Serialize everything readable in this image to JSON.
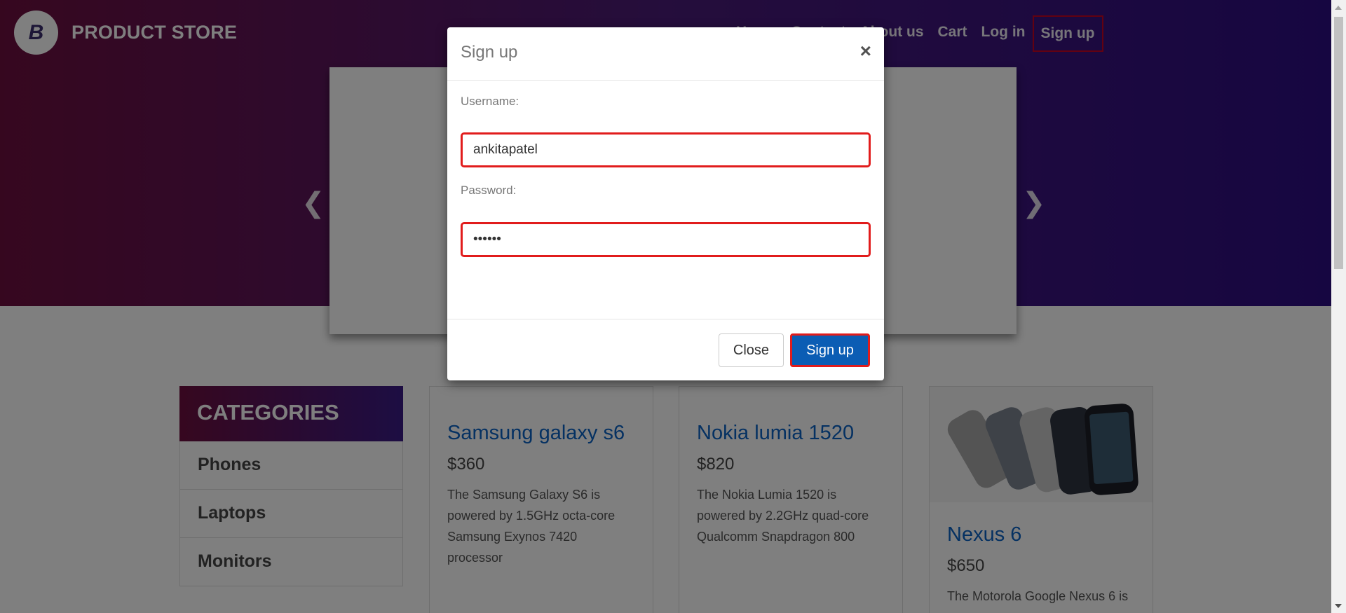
{
  "brand": {
    "name": "PRODUCT STORE",
    "logo_letter": "B"
  },
  "nav": {
    "items": [
      {
        "label": "Home"
      },
      {
        "label": "Contact"
      },
      {
        "label": "About us"
      },
      {
        "label": "Cart"
      },
      {
        "label": "Log in"
      },
      {
        "label": "Sign up"
      }
    ]
  },
  "carousel": {
    "prev_icon": "chevron-left-icon",
    "next_icon": "chevron-right-icon"
  },
  "categories": {
    "header": "CATEGORIES",
    "items": [
      "Phones",
      "Laptops",
      "Monitors"
    ]
  },
  "products": [
    {
      "title": "Samsung galaxy s6",
      "price": "$360",
      "description": "The Samsung Galaxy S6 is powered by 1.5GHz octa-core Samsung Exynos 7420 processor"
    },
    {
      "title": "Nokia lumia 1520",
      "price": "$820",
      "description": "The Nokia Lumia 1520 is powered by 2.2GHz quad-core Qualcomm Snapdragon 800"
    },
    {
      "title": "Nexus 6",
      "price": "$650",
      "description": "The Motorola Google Nexus 6 is"
    }
  ],
  "modal": {
    "title": "Sign up",
    "close_icon": "×",
    "username_label": "Username:",
    "username_value": "ankitapatel",
    "password_label": "Password:",
    "password_value": "••••••",
    "close_button": "Close",
    "signup_button": "Sign up"
  },
  "colors": {
    "accent_blue": "#0b5db4",
    "highlight_red": "#e11c1c",
    "hero_start": "#6d0f3f",
    "hero_end": "#2d0d83"
  }
}
